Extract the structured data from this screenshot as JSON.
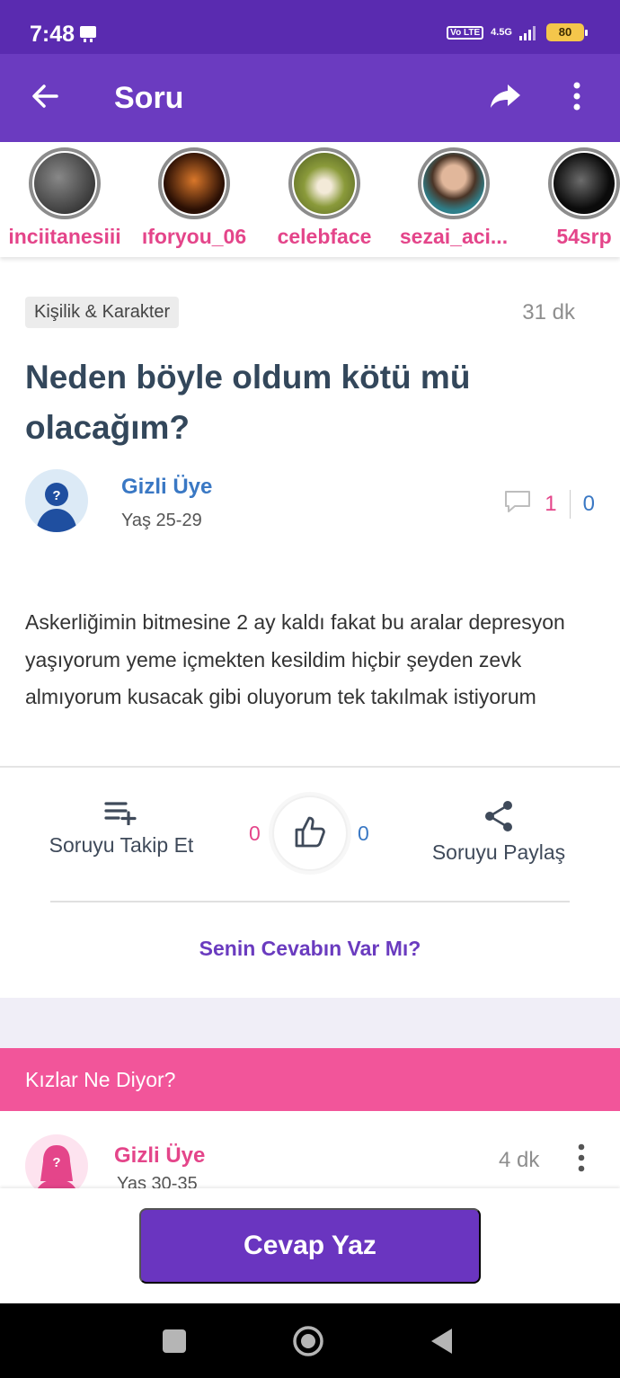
{
  "status_bar": {
    "time": "7:48",
    "network": "4.5G",
    "volte": "Vo LTE",
    "battery": "80"
  },
  "app_bar": {
    "title": "Soru"
  },
  "stories": [
    {
      "username": "inciitanesiii",
      "color": "#2b2b2b"
    },
    {
      "username": "ıforyou_06",
      "color": "#3a1a0a"
    },
    {
      "username": "celebface",
      "color": "#7c8a3a"
    },
    {
      "username": "sezai_aci...",
      "color": "#3c8890"
    },
    {
      "username": "54srp",
      "color": "#151515"
    }
  ],
  "question": {
    "category": "Kişilik & Karakter",
    "time": "31 dk",
    "title": "Neden böyle oldum kötü mü olacağım?",
    "asker": {
      "name": "Gizli Üye",
      "age": "Yaş 25-29"
    },
    "comment_count": "1",
    "other_count": "0",
    "body": "Askerliğimin bitmesine 2 ay kaldı fakat bu aralar depresyon yaşıyorum yeme içmekten kesildim hiçbir şeyden zevk almıyorum kusacak gibi oluyorum tek takılmak istiyorum"
  },
  "actions": {
    "follow_label": "Soruyu Takip Et",
    "vote_left": "0",
    "vote_right": "0",
    "share_label": "Soruyu Paylaş",
    "your_answer": "Senin Cevabın Var Mı?"
  },
  "section": {
    "girls_title": "Kızlar Ne Diyor?"
  },
  "answer": {
    "name": "Gizli Üye",
    "age": "Yaş 30-35",
    "time": "4 dk"
  },
  "cta": {
    "label": "Cevap Yaz"
  },
  "colors": {
    "primary": "#6b3bc0",
    "pink": "#f2559a",
    "blue": "#3a78c4"
  }
}
